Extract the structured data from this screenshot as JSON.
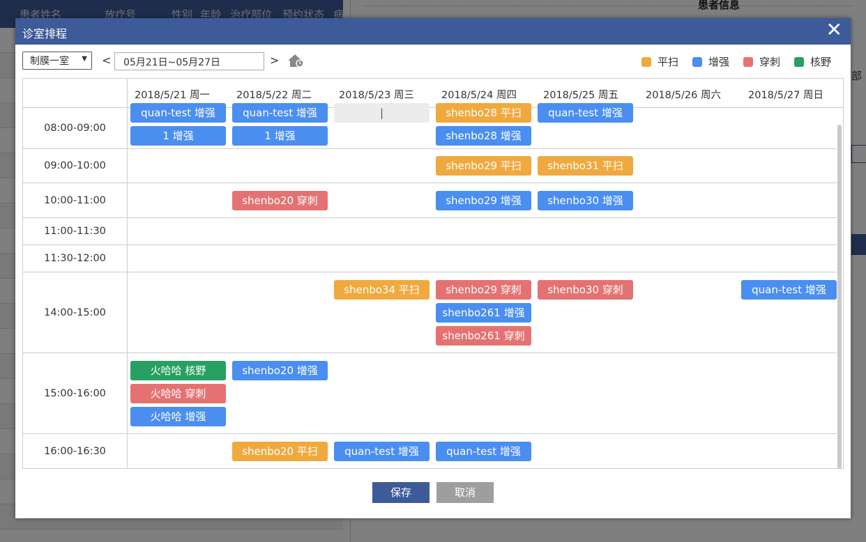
{
  "background": {
    "table_headers": [
      "患者姓名",
      "放疗号",
      "性别",
      "年龄",
      "治疗部位",
      "预约状态",
      "病"
    ],
    "panel_title": "患者信息",
    "side_label": "部"
  },
  "modal": {
    "title": "诊室排程",
    "close_label": "✕",
    "room": "制膜一室",
    "prev_label": "<",
    "next_label": ">",
    "date_range": "05月21日~05月27日",
    "legend": [
      {
        "label": "平扫",
        "color": "#f0a93f"
      },
      {
        "label": "增强",
        "color": "#4a8ef0"
      },
      {
        "label": "穿刺",
        "color": "#e57272"
      },
      {
        "label": "核野",
        "color": "#27a061"
      }
    ],
    "days": [
      "2018/5/21 周一",
      "2018/5/22 周二",
      "2018/5/23 周三",
      "2018/5/24 周四",
      "2018/5/25 周五",
      "2018/5/26 周六",
      "2018/5/27 周日"
    ],
    "slots": [
      {
        "time": "08:00-09:00",
        "cells": [
          [
            {
              "text": "quan-test 增强",
              "type": "zeng"
            },
            {
              "text": "1 增强",
              "type": "zeng"
            }
          ],
          [
            {
              "text": "quan-test 增强",
              "type": "zeng"
            },
            {
              "text": "1 增强",
              "type": "zeng"
            }
          ],
          [
            {
              "text": "|",
              "type": "grey"
            }
          ],
          [
            {
              "text": "shenbo28 平扫",
              "type": "ping"
            },
            {
              "text": "shenbo28 增强",
              "type": "zeng"
            }
          ],
          [
            {
              "text": "quan-test 增强",
              "type": "zeng"
            }
          ],
          [],
          []
        ]
      },
      {
        "time": "09:00-10:00",
        "cells": [
          [],
          [],
          [],
          [
            {
              "text": "shenbo29 平扫",
              "type": "ping"
            }
          ],
          [
            {
              "text": "shenbo31 平扫",
              "type": "ping"
            }
          ],
          [],
          []
        ]
      },
      {
        "time": "10:00-11:00",
        "cells": [
          [],
          [
            {
              "text": "shenbo20 穿刺",
              "type": "chuan"
            }
          ],
          [],
          [
            {
              "text": "shenbo29 增强",
              "type": "zeng"
            }
          ],
          [
            {
              "text": "shenbo30 增强",
              "type": "zeng"
            }
          ],
          [],
          []
        ]
      },
      {
        "time": "11:00-11:30",
        "cells": [
          [],
          [],
          [],
          [],
          [],
          [],
          []
        ]
      },
      {
        "time": "11:30-12:00",
        "cells": [
          [],
          [],
          [],
          [],
          [],
          [],
          []
        ]
      },
      {
        "time": "14:00-15:00",
        "cells": [
          [],
          [],
          [
            {
              "text": "shenbo34 平扫",
              "type": "ping"
            }
          ],
          [
            {
              "text": "shenbo29 穿刺",
              "type": "chuan"
            },
            {
              "text": "shenbo261 增强",
              "type": "zeng"
            },
            {
              "text": "shenbo261 穿刺",
              "type": "chuan"
            }
          ],
          [
            {
              "text": "shenbo30 穿刺",
              "type": "chuan"
            }
          ],
          [],
          [
            {
              "text": "quan-test 增强",
              "type": "zeng"
            }
          ]
        ]
      },
      {
        "time": "15:00-16:00",
        "cells": [
          [
            {
              "text": "火哈哈 核野",
              "type": "he"
            },
            {
              "text": "火哈哈 穿刺",
              "type": "chuan"
            },
            {
              "text": "火哈哈 增强",
              "type": "zeng"
            }
          ],
          [
            {
              "text": "shenbo20 增强",
              "type": "zeng"
            }
          ],
          [],
          [],
          [],
          [],
          []
        ]
      },
      {
        "time": "16:00-16:30",
        "cells": [
          [],
          [
            {
              "text": "shenbo20 平扫",
              "type": "ping"
            }
          ],
          [
            {
              "text": "quan-test 增强",
              "type": "zeng"
            }
          ],
          [
            {
              "text": "quan-test 增强",
              "type": "zeng"
            }
          ],
          [],
          [],
          []
        ]
      }
    ],
    "save_label": "保存",
    "cancel_label": "取消"
  }
}
